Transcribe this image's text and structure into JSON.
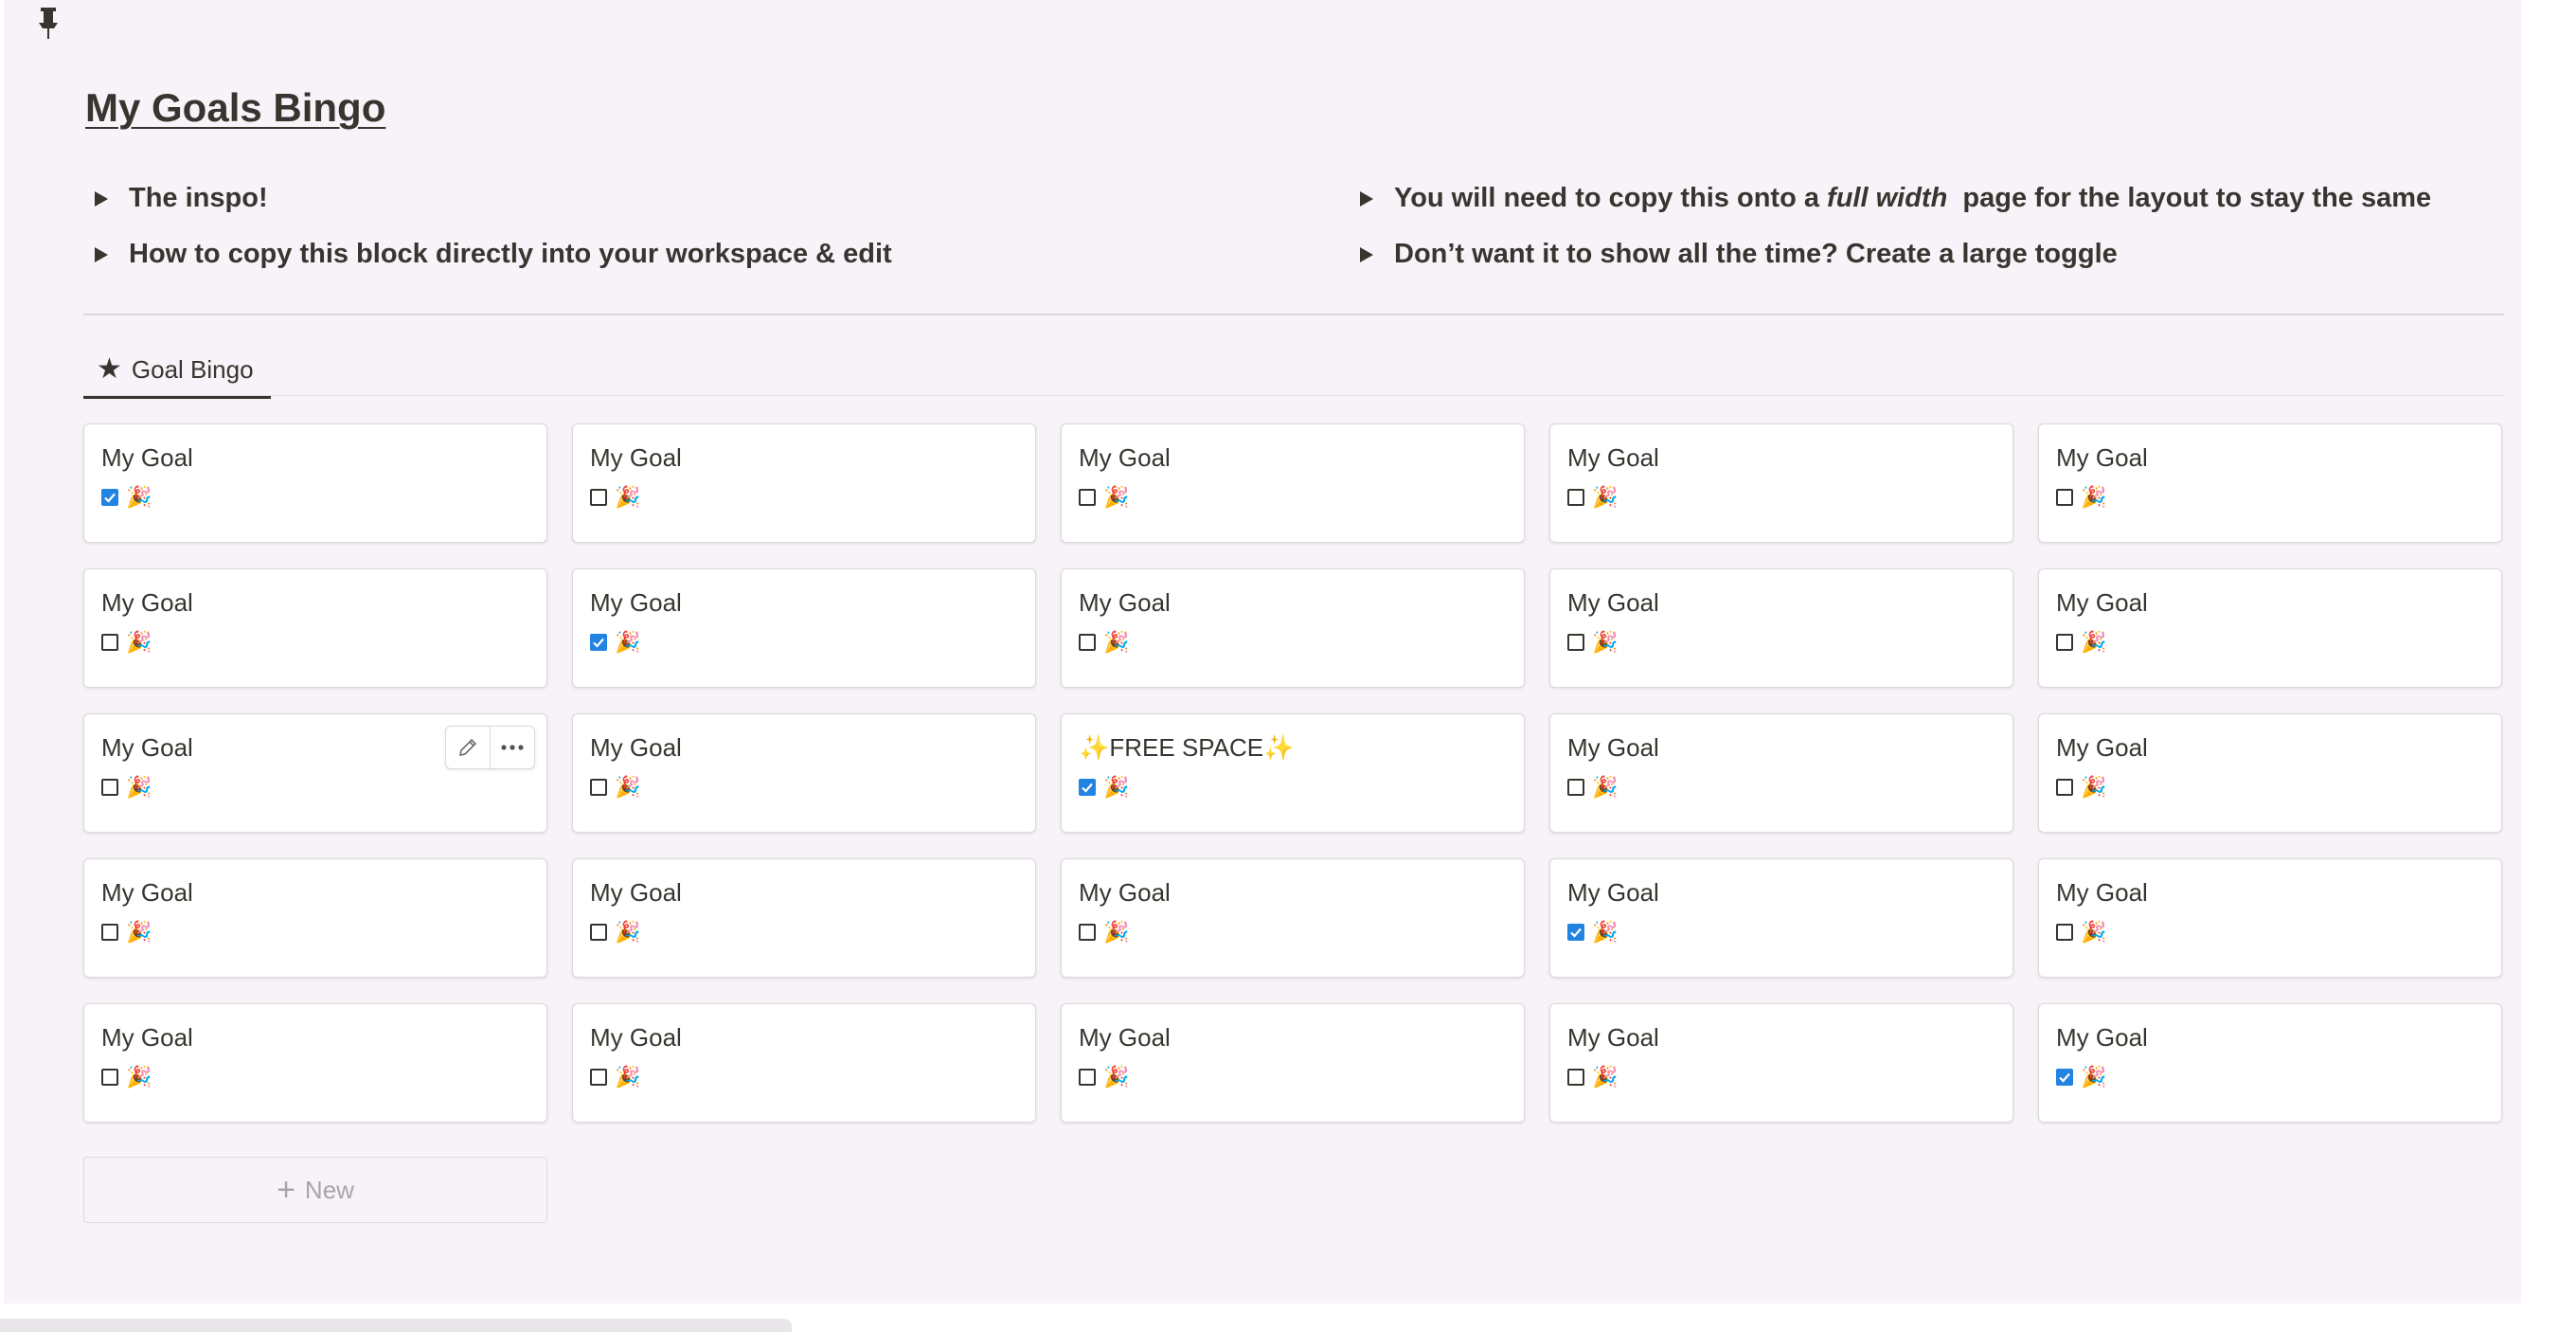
{
  "page": {
    "title": "My Goals Bingo",
    "pin_icon": "pin-icon"
  },
  "toggles": [
    {
      "text": "The inspo!"
    },
    {
      "text": "How to copy this block directly into your workspace & edit"
    },
    {
      "text_before": "You will need to copy this onto a ",
      "text_italic": "full width",
      "text_after": "  page for the layout to stay the same"
    },
    {
      "text": "Don’t want it to show all the time? Create a large toggle"
    }
  ],
  "view_tab": {
    "icon": "star-icon",
    "label": "Goal Bingo"
  },
  "cards": [
    {
      "title": "My Goal",
      "checked": true,
      "emoji": "🎉"
    },
    {
      "title": "My Goal",
      "checked": false,
      "emoji": "🎉"
    },
    {
      "title": "My Goal",
      "checked": false,
      "emoji": "🎉"
    },
    {
      "title": "My Goal",
      "checked": false,
      "emoji": "🎉"
    },
    {
      "title": "My Goal",
      "checked": false,
      "emoji": "🎉"
    },
    {
      "title": "My Goal",
      "checked": false,
      "emoji": "🎉"
    },
    {
      "title": "My Goal",
      "checked": true,
      "emoji": "🎉"
    },
    {
      "title": "My Goal",
      "checked": false,
      "emoji": "🎉"
    },
    {
      "title": "My Goal",
      "checked": false,
      "emoji": "🎉"
    },
    {
      "title": "My Goal",
      "checked": false,
      "emoji": "🎉"
    },
    {
      "title": "My Goal",
      "checked": false,
      "emoji": "🎉",
      "hover_actions": true
    },
    {
      "title": "My Goal",
      "checked": false,
      "emoji": "🎉"
    },
    {
      "title": "✨FREE SPACE✨",
      "checked": true,
      "emoji": "🎉"
    },
    {
      "title": "My Goal",
      "checked": false,
      "emoji": "🎉"
    },
    {
      "title": "My Goal",
      "checked": false,
      "emoji": "🎉"
    },
    {
      "title": "My Goal",
      "checked": false,
      "emoji": "🎉"
    },
    {
      "title": "My Goal",
      "checked": false,
      "emoji": "🎉"
    },
    {
      "title": "My Goal",
      "checked": false,
      "emoji": "🎉"
    },
    {
      "title": "My Goal",
      "checked": true,
      "emoji": "🎉"
    },
    {
      "title": "My Goal",
      "checked": false,
      "emoji": "🎉"
    },
    {
      "title": "My Goal",
      "checked": false,
      "emoji": "🎉"
    },
    {
      "title": "My Goal",
      "checked": false,
      "emoji": "🎉"
    },
    {
      "title": "My Goal",
      "checked": false,
      "emoji": "🎉"
    },
    {
      "title": "My Goal",
      "checked": false,
      "emoji": "🎉"
    },
    {
      "title": "My Goal",
      "checked": true,
      "emoji": "🎉"
    }
  ],
  "card_actions": {
    "edit_icon": "pencil-icon",
    "more_icon": "more-horizontal-icon"
  },
  "new_button": {
    "label": "New",
    "icon": "plus-icon"
  },
  "status_bar": {
    "text": ""
  },
  "colors": {
    "checkbox_checked": "#2383e2",
    "panel_bg": "#f7f3f8",
    "text": "#37352f"
  }
}
